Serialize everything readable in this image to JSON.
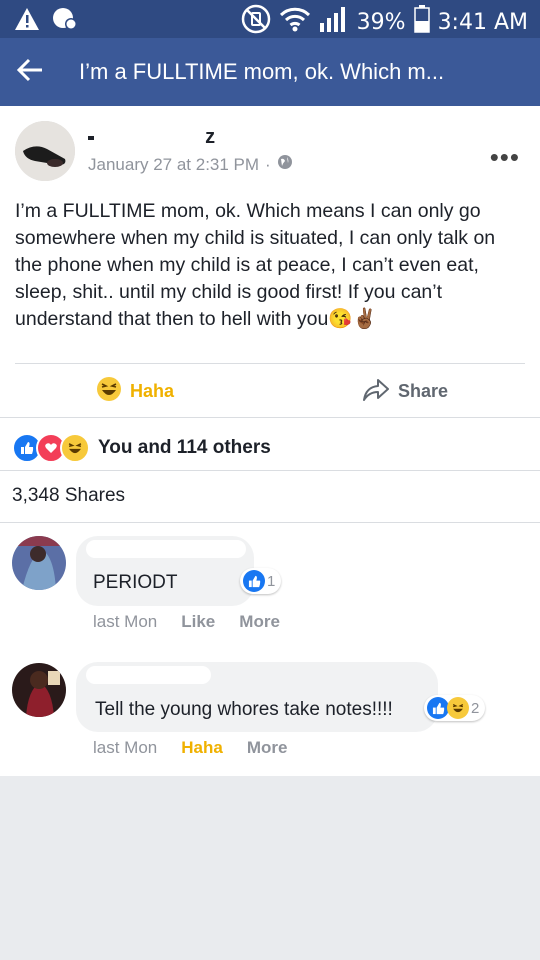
{
  "status_bar": {
    "battery": "39%",
    "time": "3:41 AM"
  },
  "header": {
    "title": "I’m a FULLTIME mom, ok. Which m..."
  },
  "post": {
    "author_visible": "z",
    "date": "January 27 at 2:31 PM",
    "separator": "·",
    "text": "I’m a FULLTIME mom, ok. Which means I can only go somewhere when my child is situated, I can only talk on the phone when my child is at peace, I can’t even eat, sleep, shit.. until my child is good first! If you can’t understand that then to hell with you",
    "text_emojis": "😘✌🏾",
    "actions": {
      "haha_label": "Haha",
      "share_label": "Share"
    },
    "reactions_text": "You and 114 others",
    "shares_text": "3,348 Shares"
  },
  "comments": [
    {
      "text": "PERIODT",
      "reaction_count": "1",
      "time": "last Mon",
      "action_label": "Like",
      "more_label": "More"
    },
    {
      "text": "Tell the young whores take notes!!!!",
      "reaction_count": "2",
      "time": "last Mon",
      "action_label": "Haha",
      "more_label": "More"
    }
  ],
  "colors": {
    "header_blue": "#3b5998",
    "status_blue": "#2f4a82",
    "haha_yellow": "#f0b100",
    "text": "#1d2129",
    "meta_gray": "#90949c",
    "like_blue": "#1877f2",
    "love_red": "#f33e58"
  },
  "icons": [
    "warning-icon",
    "notification-icon",
    "mute-icon",
    "wifi-icon",
    "signal-icon",
    "battery-icon",
    "back-arrow-icon",
    "globe-icon",
    "more-icon",
    "haha-icon",
    "share-icon",
    "like-icon",
    "love-icon"
  ]
}
